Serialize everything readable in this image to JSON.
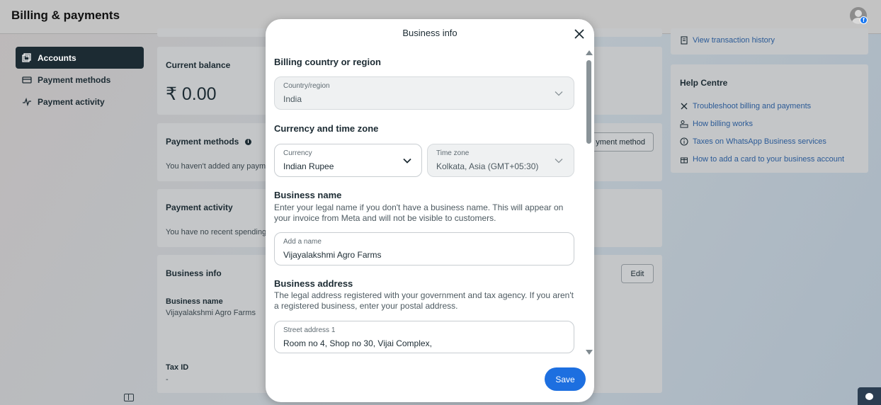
{
  "app": {
    "title": "Billing & payments"
  },
  "sidebar": {
    "items": [
      {
        "label": "Accounts",
        "icon": "accounts-icon",
        "active": true
      },
      {
        "label": "Payment methods",
        "icon": "card-icon",
        "active": false
      },
      {
        "label": "Payment activity",
        "icon": "activity-icon",
        "active": false
      }
    ]
  },
  "main": {
    "balance": {
      "title": "Current balance",
      "amount": "₹ 0.00"
    },
    "payment_methods": {
      "title": "Payment methods",
      "text": "You haven't added any paym",
      "button": "yment method"
    },
    "payment_activity": {
      "title": "Payment activity",
      "text": "You have no recent spending"
    },
    "business_info": {
      "title": "Business info",
      "edit_label": "Edit",
      "name_label": "Business name",
      "name_value": "Vijayalakshmi Agro Farms",
      "tax_label": "Tax ID",
      "tax_value": "-"
    }
  },
  "right": {
    "transaction_link": "View transaction history",
    "help": {
      "title": "Help Centre",
      "links": [
        {
          "label": "Troubleshoot billing and payments",
          "icon": "tools-icon"
        },
        {
          "label": "How billing works",
          "icon": "people-icon"
        },
        {
          "label": "Taxes on WhatsApp Business services",
          "icon": "info-icon"
        },
        {
          "label": "How to add a card to your business account",
          "icon": "gift-icon"
        }
      ]
    }
  },
  "modal": {
    "title": "Business info",
    "country_section": "Billing country or region",
    "country": {
      "label": "Country/region",
      "value": "India"
    },
    "currency_section": "Currency and time zone",
    "currency": {
      "label": "Currency",
      "value": "Indian Rupee"
    },
    "timezone": {
      "label": "Time zone",
      "value": "Kolkata, Asia (GMT+05:30)"
    },
    "name_section": "Business name",
    "name_desc": "Enter your legal name if you don't have a business name. This will appear on your invoice from Meta and will not be visible to customers.",
    "name_field": {
      "label": "Add a name",
      "value": "Vijayalakshmi Agro Farms"
    },
    "address_section": "Business address",
    "address_desc": "The legal address registered with your government and tax agency. If you aren't a registered business, enter your postal address.",
    "street1": {
      "label": "Street address 1",
      "value": "Room no 4, Shop no 30, Vijai Complex,"
    },
    "save_label": "Save"
  },
  "colors": {
    "accent": "#1d6fe0",
    "nav_active": "#1c2b33"
  }
}
